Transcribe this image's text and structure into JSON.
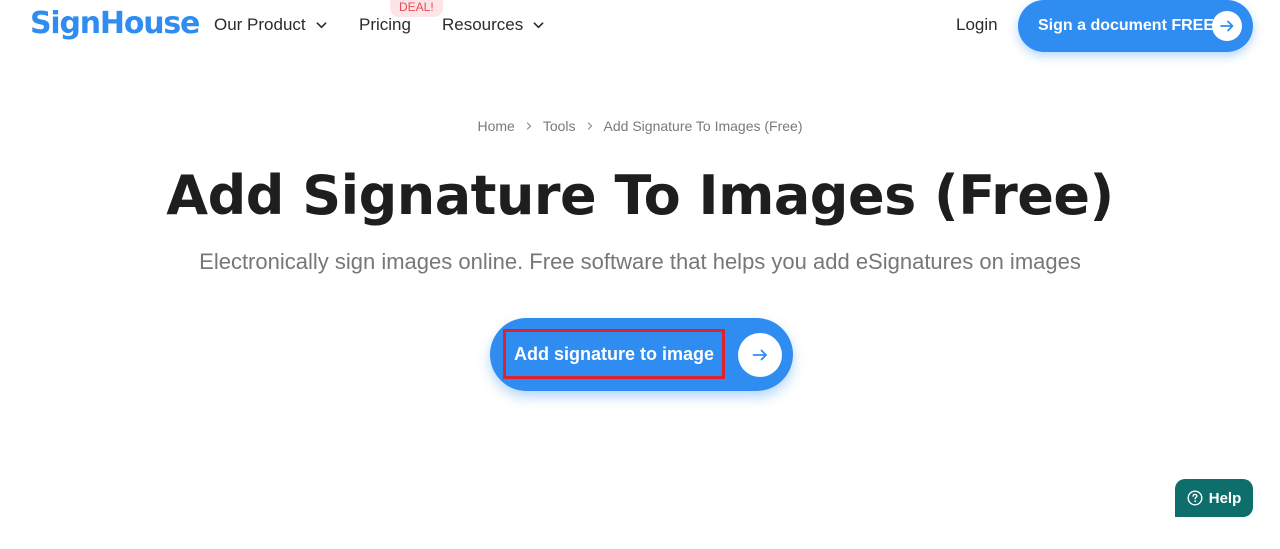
{
  "brand": {
    "logo_text": "SignHouse",
    "color": "#2f8cf0"
  },
  "nav": {
    "items": [
      {
        "label": "Our Product",
        "dropdown": true
      },
      {
        "label": "Pricing",
        "dropdown": false,
        "badge": "DEAL!"
      },
      {
        "label": "Resources",
        "dropdown": true
      }
    ],
    "login_label": "Login",
    "cta_label": "Sign a document FREE"
  },
  "breadcrumb": [
    "Home",
    "Tools",
    "Add Signature To Images (Free)"
  ],
  "hero": {
    "title": "Add Signature To Images (Free)",
    "subtitle": "Electronically sign images online. Free software that helps you add eSignatures on images",
    "cta_label": "Add signature to image"
  },
  "help": {
    "label": "Help"
  },
  "colors": {
    "primary": "#2f8cf0",
    "badge_bg": "#fde5e7",
    "badge_text": "#e74c5a",
    "help_bg": "#0e6e6b",
    "highlight_border": "#e0212f"
  }
}
